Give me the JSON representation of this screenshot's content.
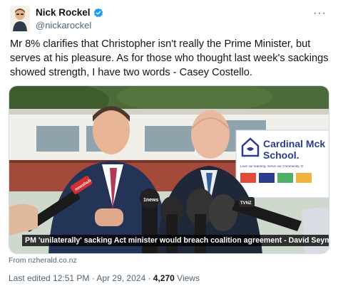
{
  "author": {
    "display_name": "Nick Rockel",
    "handle": "@nickarockel",
    "avatar_icon": "avatar-caricature",
    "verified_icon": "verified-badge-icon",
    "verified_color": "#1d9bf0"
  },
  "tweet": {
    "text": "Mr 8% clarifies that Christopher isn't really the Prime Minister, but serves at his pleasure.  As for those who thought last week's sackings showed strength, I have two words - Casey Costello."
  },
  "media": {
    "caption": "PM 'unilaterally' sacking Act minister would breach coalition agreement - David Seymour",
    "sign_line1": "Cardinal Mck",
    "sign_line2": "School.",
    "sign_tagline": "Love our learning. Serve our Community. G",
    "mic_brand_left": "newshub",
    "mic_brand_center": "1news",
    "mic_brand_right": "TVNZ"
  },
  "source": {
    "label": "From nzherald.co.nz"
  },
  "meta": {
    "edited_prefix": "Last edited 12:51 PM · Apr 29, 2024 · ",
    "views_count": "4,270",
    "views_suffix": " Views"
  },
  "colors": {
    "text_primary": "#0f1419",
    "text_secondary": "#536471",
    "accent": "#1d9bf0",
    "mic_red": "#d32f2f"
  }
}
